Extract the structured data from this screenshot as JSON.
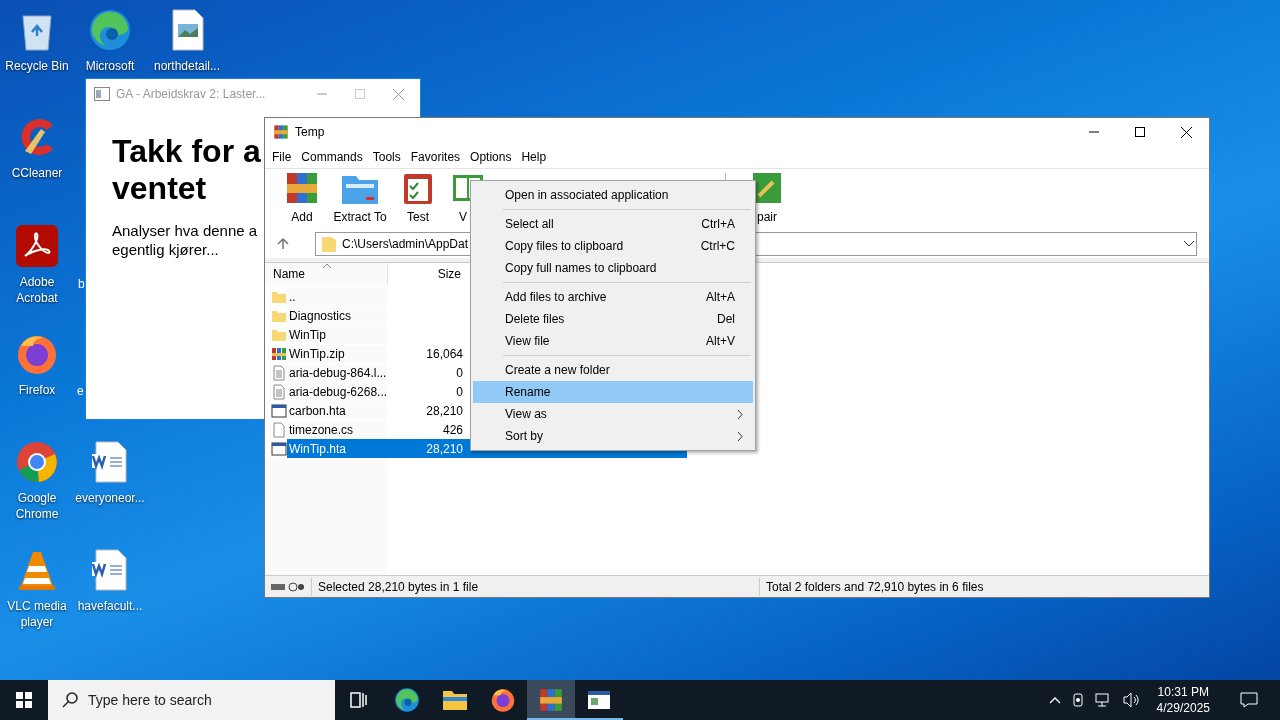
{
  "desktop_icons": [
    {
      "label": "Recycle Bin",
      "kind": "recycle"
    },
    {
      "label": "Microsoft",
      "kind": "edge"
    },
    {
      "label": "northdetail...",
      "kind": "image"
    },
    {
      "label": "CCleaner",
      "kind": "ccleaner"
    },
    {
      "label": "Adobe Acrobat",
      "kind": "acrobat"
    },
    {
      "label": "Firefox",
      "kind": "firefox"
    },
    {
      "label": "Google Chrome",
      "kind": "chrome"
    },
    {
      "label": "everyoneor...",
      "kind": "word"
    },
    {
      "label": "VLC media player",
      "kind": "vlc"
    },
    {
      "label": "havefacult...",
      "kind": "word"
    }
  ],
  "desktop_label_fragments": [
    "b",
    "e"
  ],
  "ga_window": {
    "title": "GA - Arbeidskrav 2: Laster...",
    "heading_lines": [
      "Takk for a",
      "ventet"
    ],
    "paragraph_lines": [
      "Analyser hva denne a",
      "egentlig kjører..."
    ]
  },
  "winrar": {
    "title": "Temp",
    "menu": [
      "File",
      "Commands",
      "Tools",
      "Favorites",
      "Options",
      "Help"
    ],
    "toolbar": [
      {
        "label": "Add",
        "kind": "add"
      },
      {
        "label": "Extract To",
        "kind": "extract"
      },
      {
        "label": "Test",
        "kind": "test"
      },
      {
        "label": "V",
        "kind": "view"
      }
    ],
    "toolbar_right": {
      "label": "pair",
      "kind": "repair"
    },
    "address": "C:\\Users\\admin\\AppDat",
    "columns": [
      "Name",
      "Size"
    ],
    "rows": [
      {
        "name": "..",
        "size": "",
        "kind": "folder",
        "selected": false
      },
      {
        "name": "Diagnostics",
        "size": "",
        "kind": "folder",
        "selected": false
      },
      {
        "name": "WinTip",
        "size": "",
        "kind": "folder",
        "selected": false
      },
      {
        "name": "WinTip.zip",
        "size": "16,064",
        "kind": "archive",
        "selected": false
      },
      {
        "name": "aria-debug-864.l...",
        "size": "0",
        "kind": "text",
        "selected": false
      },
      {
        "name": "aria-debug-6268...",
        "size": "0",
        "kind": "text",
        "selected": false
      },
      {
        "name": "carbon.hta",
        "size": "28,210",
        "kind": "hta",
        "selected": false
      },
      {
        "name": "timezone.cs",
        "size": "426",
        "kind": "file",
        "selected": false
      },
      {
        "name": "WinTip.hta",
        "size": "28,210",
        "kind": "hta",
        "selected": true
      }
    ],
    "status_left": "Selected 28,210 bytes in 1 file",
    "status_right": "Total 2 folders and 72,910 bytes in 6 files"
  },
  "context_menu": [
    {
      "kind": "item",
      "label": "Open in associated application",
      "selected": false
    },
    {
      "kind": "separator"
    },
    {
      "kind": "item",
      "label": "Select all",
      "shortcut": "Ctrl+A",
      "selected": false
    },
    {
      "kind": "item",
      "label": "Copy files to clipboard",
      "shortcut": "Ctrl+C",
      "selected": false
    },
    {
      "kind": "item",
      "label": "Copy full names to clipboard",
      "selected": false
    },
    {
      "kind": "separator"
    },
    {
      "kind": "item",
      "label": "Add files to archive",
      "shortcut": "Alt+A",
      "selected": false
    },
    {
      "kind": "item",
      "label": "Delete files",
      "shortcut": "Del",
      "selected": false
    },
    {
      "kind": "item",
      "label": "View file",
      "shortcut": "Alt+V",
      "selected": false
    },
    {
      "kind": "separator"
    },
    {
      "kind": "item",
      "label": "Create a new folder",
      "selected": false
    },
    {
      "kind": "item",
      "label": "Rename",
      "selected": true
    },
    {
      "kind": "item",
      "label": "View as",
      "submenu": true,
      "selected": false
    },
    {
      "kind": "item",
      "label": "Sort by",
      "submenu": true,
      "selected": false
    }
  ],
  "taskbar": {
    "search_placeholder": "Type here to search",
    "apps": [
      {
        "kind": "taskview",
        "selected": false,
        "running": false
      },
      {
        "kind": "edge",
        "selected": false,
        "running": false
      },
      {
        "kind": "explorer",
        "selected": false,
        "running": false
      },
      {
        "kind": "firefox",
        "selected": false,
        "running": false
      },
      {
        "kind": "winrar",
        "selected": true,
        "running": true
      },
      {
        "kind": "window",
        "selected": false,
        "running": true
      }
    ],
    "time": "10:31 PM",
    "date": "4/29/2025"
  }
}
